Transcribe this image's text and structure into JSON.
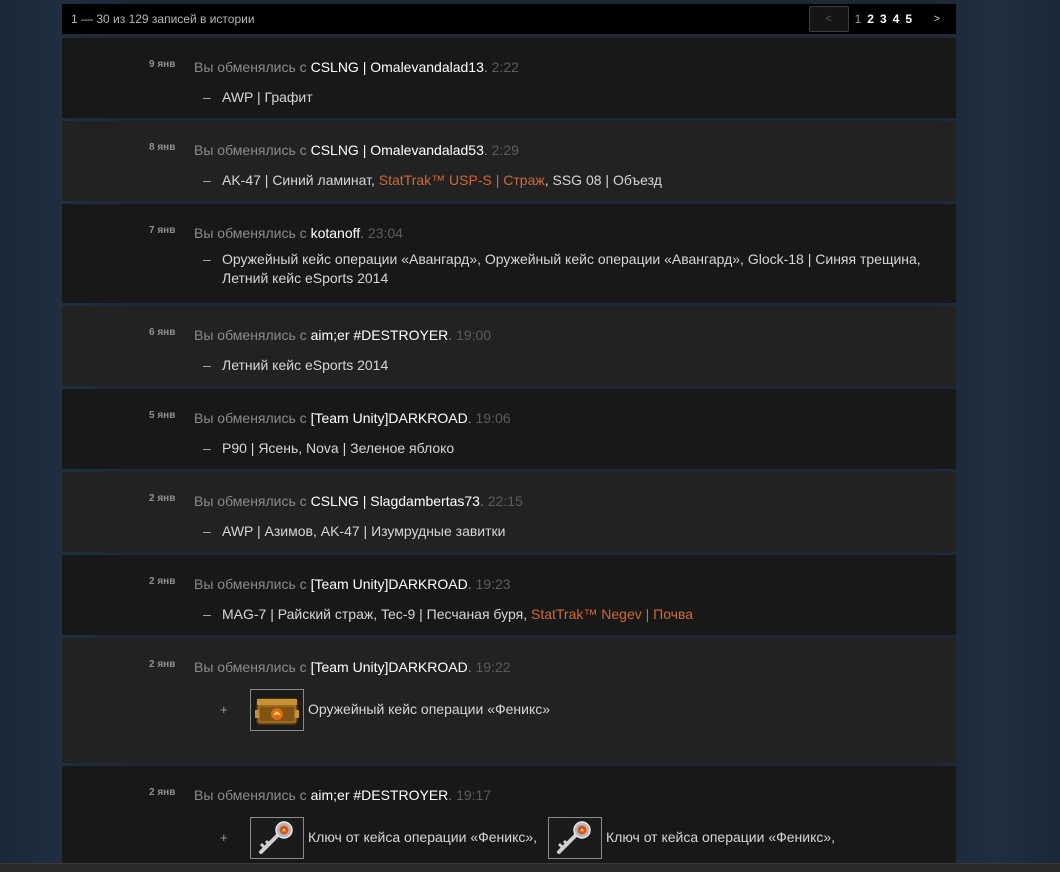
{
  "pager": {
    "count_text": "1 — 30 из 129 записей в истории",
    "prev": "<",
    "pages": [
      "1",
      "2",
      "3",
      "4",
      "5"
    ],
    "next": ">"
  },
  "trade_prefix": "Вы обменялись с ",
  "entries": [
    {
      "date": "9 янв",
      "user": "CSLNG | Omalevandalad13",
      "time": "2:22",
      "items_line1": "AWP | Графит",
      "items_line2": ""
    },
    {
      "date": "8 янв",
      "user": "CSLNG | Omalevandalad53",
      "time": "2:29",
      "parts": [
        "AK-47 | Синий ламинат, ",
        "StatTrak™ USP-S | Страж",
        ", SSG 08 | Объезд"
      ]
    },
    {
      "date": "7 янв",
      "user": "kotanoff",
      "time": "23:04",
      "items_line1": "Оружейный кейс операции «Авангард», Оружейный кейс операции «Авангард», Glock-18 | Синяя трещина,",
      "items_line2": "Летний кейс eSports 2014"
    },
    {
      "date": "6 янв",
      "user": "aim;er #DESTROYER",
      "time": "19:00",
      "items_line1": "Летний кейс eSports 2014",
      "items_line2": ""
    },
    {
      "date": "5 янв",
      "user": "[Team Unity]DARKROAD",
      "time": "19:06",
      "items_line1": "P90 | Ясень, Nova | Зеленое яблоко",
      "items_line2": ""
    },
    {
      "date": "2 янв",
      "user": "CSLNG | Slagdambertas73",
      "time": "22:15",
      "items_line1": "AWP | Азимов, AK-47 | Изумрудные завитки",
      "items_line2": ""
    },
    {
      "date": "2 янв",
      "user": "[Team Unity]DARKROAD",
      "time": "19:23",
      "parts": [
        "MAG-7 | Райский страж, Tec-9 | Песчаная буря, ",
        "StatTrak™ Negev | Почва",
        ""
      ]
    },
    {
      "date": "2 янв",
      "user": "[Team Unity]DARKROAD",
      "time": "19:22",
      "received": [
        "Оружейный кейс операции «Феникс»"
      ]
    },
    {
      "date": "2 янв",
      "user": "aim;er #DESTROYER",
      "time": "19:17",
      "received": [
        "Ключ от кейса операции «Феникс»,",
        "Ключ от кейса операции «Феникс»,"
      ]
    }
  ],
  "symbols": {
    "dash": "–",
    "plus": "+",
    "dot": "."
  },
  "icons": {
    "case": "phoenix-case-icon",
    "key": "phoenix-key-icon"
  },
  "colors": {
    "stattrak": "#cf6a32",
    "user": "#ffffff"
  }
}
